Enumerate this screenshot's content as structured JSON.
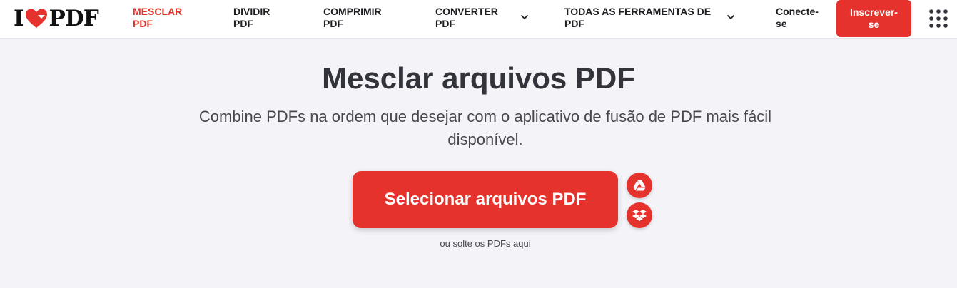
{
  "header": {
    "logo_left": "I",
    "logo_right": "PDF",
    "nav": [
      {
        "label": "MESCLAR PDF",
        "active": true
      },
      {
        "label": "DIVIDIR PDF",
        "active": false
      },
      {
        "label": "COMPRIMIR PDF",
        "active": false
      },
      {
        "label": "CONVERTER PDF",
        "active": false,
        "dropdown": true
      },
      {
        "label": "TODAS AS FERRAMENTAS DE PDF",
        "active": false,
        "dropdown": true
      }
    ],
    "login_label": "Conecte-se",
    "signup_label": "Inscrever-se",
    "apps_icon": "grid-icon"
  },
  "main": {
    "title": "Mesclar arquivos PDF",
    "subtitle": "Combine PDFs na ordem que desejar com o aplicativo de fusão de PDF mais fácil disponível.",
    "select_button_label": "Selecionar arquivos PDF",
    "cloud_buttons": [
      "google-drive-icon",
      "dropbox-icon"
    ],
    "drop_hint": "ou solte os PDFs aqui"
  },
  "colors": {
    "accent": "#e5322d",
    "background": "#f4f4f8",
    "text": "#33333b"
  }
}
